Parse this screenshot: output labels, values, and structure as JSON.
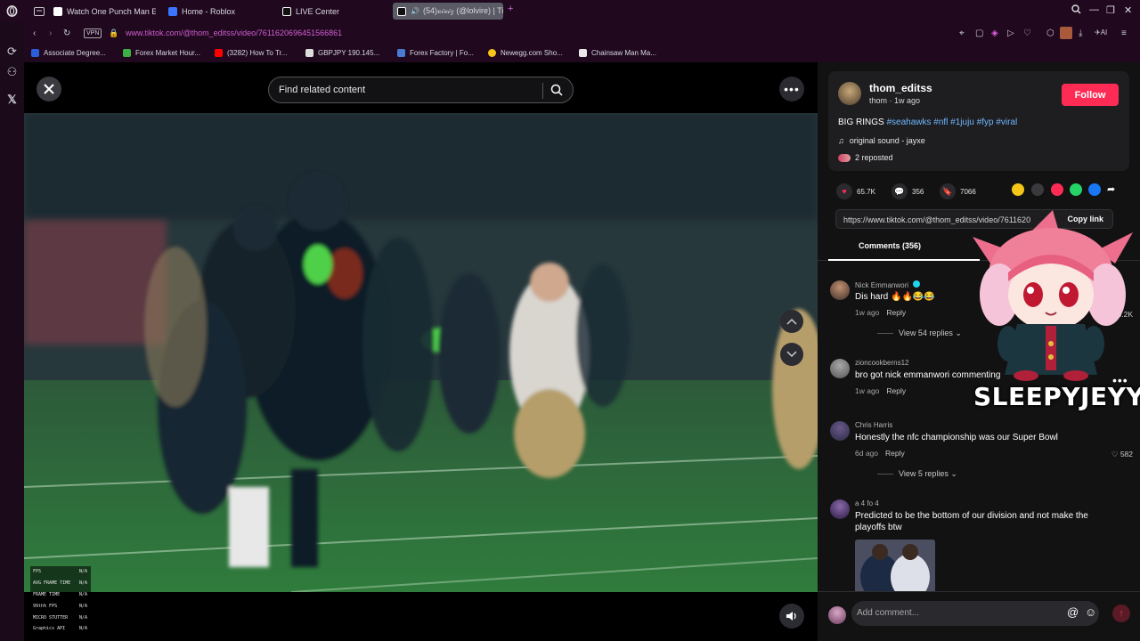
{
  "tabs": [
    {
      "label": "Watch One Punch Man En",
      "color": "#ffffff"
    },
    {
      "label": "Home - Roblox",
      "color": "#3b74ff"
    },
    {
      "label": "LIVE Center",
      "color": "#222222"
    },
    {
      "label": "(54)𝓋𝒾𝓋𝒾𝓏 (@lolvire) | Ti",
      "color": "#ffffff"
    }
  ],
  "address": {
    "vpn": "VPN",
    "url": "www.tiktok.com/@thom_editss/video/7611620696451566861"
  },
  "bookmarks": [
    {
      "label": "Associate Degree...",
      "color": "#2b5fd9"
    },
    {
      "label": "Forex Market Hour...",
      "color": "#3cb043"
    },
    {
      "label": "(3282) How To Tr...",
      "color": "#ff0000"
    },
    {
      "label": "GBPJPY 190.145...",
      "color": "#dddddd"
    },
    {
      "label": "Forex Factory | Fo...",
      "color": "#4a7bd0"
    },
    {
      "label": "Newegg.com Sho...",
      "color": "#f5c518"
    },
    {
      "label": "Chainsaw Man Ma...",
      "color": "#e8e8e8"
    }
  ],
  "video": {
    "search_placeholder": "Find related content",
    "fps_overlay": [
      {
        "k": "FPS",
        "v": "N/A"
      },
      {
        "k": "AVG FRAME TIME",
        "v": "N/A"
      },
      {
        "k": "FRAME TIME",
        "v": "N/A"
      },
      {
        "k": "99th% FPS",
        "v": "N/A"
      },
      {
        "k": "MICRO STUTTER",
        "v": "N/A"
      },
      {
        "k": "Graphics API",
        "v": "N/A"
      }
    ]
  },
  "post": {
    "username": "thom_editss",
    "sub": "thom · 1w ago",
    "follow_label": "Follow",
    "caption_text": "BIG RINGS ",
    "hashtags": "#seahawks #nfl #1juju #fyp #viral",
    "sound": "original sound - jayxe",
    "reposted": "2 reposted",
    "likes": "65.7K",
    "comments_count": "356",
    "saves": "7066",
    "link": "https://www.tiktok.com/@thom_editss/video/7611620",
    "copy_label": "Copy link",
    "comments_tab": "Comments (356)"
  },
  "comments": [
    {
      "user": "Nick Emmanwori",
      "text": "Dis hard 🔥🔥😂😂",
      "time": "1w ago",
      "reply": "Reply",
      "likes": "15.2K",
      "replies": "View 54 replies"
    },
    {
      "user": "zioncookberns12",
      "text": "bro got nick emmanwori commenting",
      "time": "1w ago",
      "reply": "Reply",
      "likes": "",
      "replies": ""
    },
    {
      "user": "Chris Harris",
      "text": "Honestly the nfc championship was our Super Bowl",
      "time": "6d ago",
      "reply": "Reply",
      "likes": "582",
      "replies": "View 5 replies"
    },
    {
      "user": "a 4 fo 4",
      "text": "Predicted to be the bottom of our division and not make the playoffs btw",
      "time": "",
      "reply": "",
      "likes": "",
      "replies": ""
    }
  ],
  "add_comment_placeholder": "Add comment...",
  "overlay_text": "SLEEPYJEYY",
  "colors": {
    "accent": "#fe2c55",
    "hashtag": "#6fb7ff",
    "url": "#d05fd0"
  }
}
